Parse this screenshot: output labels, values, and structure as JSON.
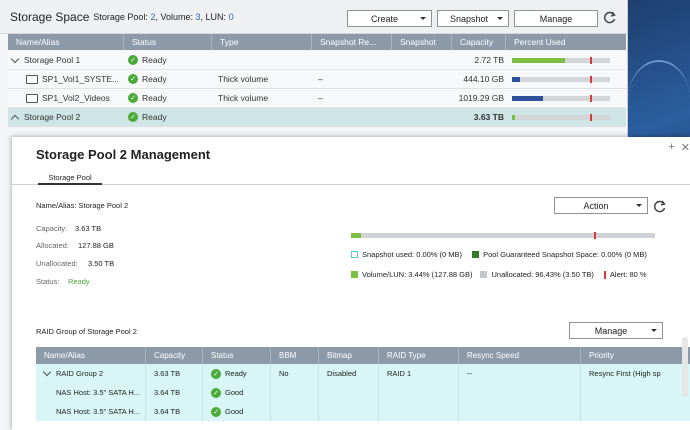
{
  "storage_space": {
    "title": "Storage Space",
    "summary_prefix": "Storage Pool:",
    "pool_count": "2",
    "volume_label": ", Volume:",
    "volume_count": "3",
    "lun_label": ", LUN:",
    "lun_count": "0",
    "buttons": {
      "create": "Create",
      "snapshot": "Snapshot",
      "manage": "Manage"
    },
    "columns": [
      "Name/Alias",
      "Status",
      "Type",
      "Snapshot Re...",
      "Snapshot",
      "Capacity",
      "Percent Used"
    ],
    "rows": [
      {
        "name": "Storage Pool 1",
        "status": "Ready",
        "type": "",
        "snapshot_re": "",
        "snapshot": "",
        "capacity": "2.72 TB",
        "percent_used": 0.54,
        "fill_color": "#7cc043",
        "alert": 0.8
      },
      {
        "name": "SP1_Vol1_SYSTE...",
        "status": "Ready",
        "type": "Thick volume",
        "snapshot_re": "–",
        "snapshot": "",
        "capacity": "444.10 GB",
        "percent_used": 0.08,
        "fill_color": "#2e4f9b",
        "alert": 0.8
      },
      {
        "name": "SP1_Vol2_Videos",
        "status": "Ready",
        "type": "Thick volume",
        "snapshot_re": "–",
        "snapshot": "",
        "capacity": "1019.29 GB",
        "percent_used": 0.32,
        "fill_color": "#2e4f9b",
        "alert": 0.8
      },
      {
        "name": "Storage Pool 2",
        "status": "Ready",
        "type": "",
        "snapshot_re": "",
        "snapshot": "",
        "capacity": "3.63 TB",
        "percent_used": 0.03,
        "fill_color": "#7cc043",
        "alert": 0.8
      }
    ]
  },
  "modal": {
    "title": "Storage Pool 2 Management",
    "tab": "Storage Pool",
    "name_alias": "Name/Alias: Storage Pool 2",
    "capacity_label": "Capacity:",
    "capacity_value": "3.63 TB",
    "allocated_label": "Allocated:",
    "allocated_value": "127.88 GB",
    "unallocated_label": "Unallocated:",
    "unallocated_value": "3.50 TB",
    "status_label": "Status:",
    "status_value": "Ready",
    "action_button": "Action",
    "pool_usage": {
      "used_fraction": 0.0344,
      "alert_fraction": 0.8
    },
    "legend": {
      "snapshot_used": "Snapshot used: 0.00% (0 MB)",
      "pool_guaranteed": "Pool Guaranteed Snapshot Space: 0.00% (0 MB)",
      "volume_lun": "Volume/LUN: 3.44% (127.88 GB)",
      "unallocated": "Unallocated: 96.43% (3.50 TB)",
      "alert": "Alert: 80 %"
    },
    "raid_group_label": "RAID Group of Storage Pool 2",
    "manage_button": "Manage",
    "raid_columns": [
      "Name/Alias",
      "Capacity",
      "Status",
      "BBM",
      "Bitmap",
      "RAID Type",
      "Resync Speed",
      "Priority"
    ],
    "raid_rows": [
      {
        "name": "RAID Group 2",
        "capacity": "3.63 TB",
        "status": "Ready",
        "bbm": "No",
        "bitmap": "Disabled",
        "raid_type": "RAID 1",
        "resync": "--",
        "priority": "Resync First (High sp"
      },
      {
        "name": "NAS Host: 3.5\" SATA H...",
        "capacity": "3.64 TB",
        "status": "Good",
        "bbm": "",
        "bitmap": "",
        "raid_type": "",
        "resync": "",
        "priority": ""
      },
      {
        "name": "NAS Host: 3.5\" SATA H...",
        "capacity": "3.64 TB",
        "status": "Good",
        "bbm": "",
        "bitmap": "",
        "raid_type": "",
        "resync": "",
        "priority": ""
      }
    ]
  },
  "colors": {
    "header_bg": "#8c9aa8",
    "selected_row": "#cfe4e4",
    "ready_green": "#4caa3a",
    "alert_red": "#d63b3b",
    "raid_row_bg": "#d8f6f6"
  }
}
